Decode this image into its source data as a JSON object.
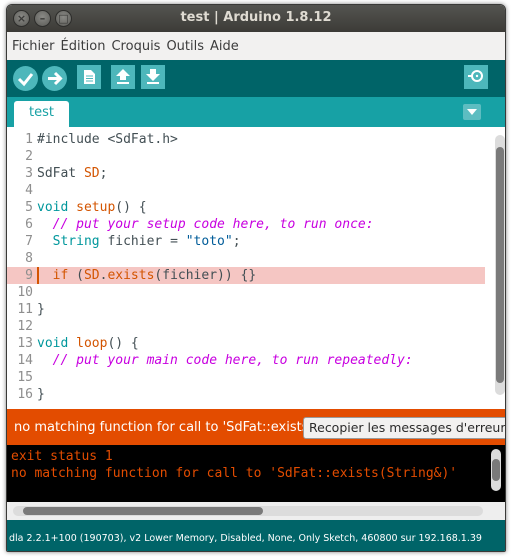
{
  "window": {
    "title": "test | Arduino 1.8.12"
  },
  "menubar": {
    "items": [
      "Fichier",
      "Édition",
      "Croquis",
      "Outils",
      "Aide"
    ]
  },
  "toolbar": {
    "buttons": [
      "verify-icon",
      "upload-icon",
      "new-icon",
      "open-icon",
      "save-icon",
      "serial-monitor-icon"
    ]
  },
  "tabs": {
    "active": "test"
  },
  "editor": {
    "lines": [
      {
        "n": "1",
        "parts": [
          [
            "",
            "#include <SdFat.h>"
          ]
        ]
      },
      {
        "n": "2",
        "parts": []
      },
      {
        "n": "3",
        "parts": [
          [
            "",
            "SdFat "
          ],
          [
            "fn",
            "SD"
          ],
          [
            "",
            ";"
          ]
        ]
      },
      {
        "n": "4",
        "parts": []
      },
      {
        "n": "5",
        "parts": [
          [
            "kw",
            "void"
          ],
          [
            "",
            " "
          ],
          [
            "fn",
            "setup"
          ],
          [
            "",
            "() {"
          ]
        ]
      },
      {
        "n": "6",
        "parts": [
          [
            "",
            "  "
          ],
          [
            "cm",
            "// put your setup code here, to run once:"
          ]
        ]
      },
      {
        "n": "7",
        "parts": [
          [
            "",
            "  "
          ],
          [
            "kw",
            "String"
          ],
          [
            "",
            " fichier = "
          ],
          [
            "str",
            "\"toto\""
          ],
          [
            "",
            ";"
          ]
        ]
      },
      {
        "n": "8",
        "parts": []
      },
      {
        "n": "9",
        "parts": [
          [
            "",
            "  "
          ],
          [
            "fn",
            "if"
          ],
          [
            "",
            " ("
          ],
          [
            "fn",
            "SD"
          ],
          [
            "",
            "."
          ],
          [
            "fn",
            "exists"
          ],
          [
            "",
            "(fichier)) {}"
          ]
        ],
        "highlight": true
      },
      {
        "n": "10",
        "parts": []
      },
      {
        "n": "11",
        "parts": [
          [
            "",
            "}"
          ]
        ]
      },
      {
        "n": "12",
        "parts": []
      },
      {
        "n": "13",
        "parts": [
          [
            "kw",
            "void"
          ],
          [
            "",
            " "
          ],
          [
            "fn",
            "loop"
          ],
          [
            "",
            "() {"
          ]
        ]
      },
      {
        "n": "14",
        "parts": [
          [
            "",
            "  "
          ],
          [
            "cm",
            "// put your main code here, to run repeatedly:"
          ]
        ]
      },
      {
        "n": "15",
        "parts": []
      },
      {
        "n": "16",
        "parts": [
          [
            "",
            "}"
          ]
        ]
      }
    ]
  },
  "errorbar": {
    "message": "no matching function for call to 'SdFat::exists(String&)'",
    "copy_button": "Recopier les messages d'erreur"
  },
  "console": {
    "lines": [
      "exit status 1",
      "no matching function for call to 'SdFat::exists(String&)'"
    ]
  },
  "statusbar": {
    "text": "dla 2.2.1+100 (190703), v2 Lower Memory, Disabled, None, Only Sketch, 460800 sur 192.168.1.39"
  }
}
